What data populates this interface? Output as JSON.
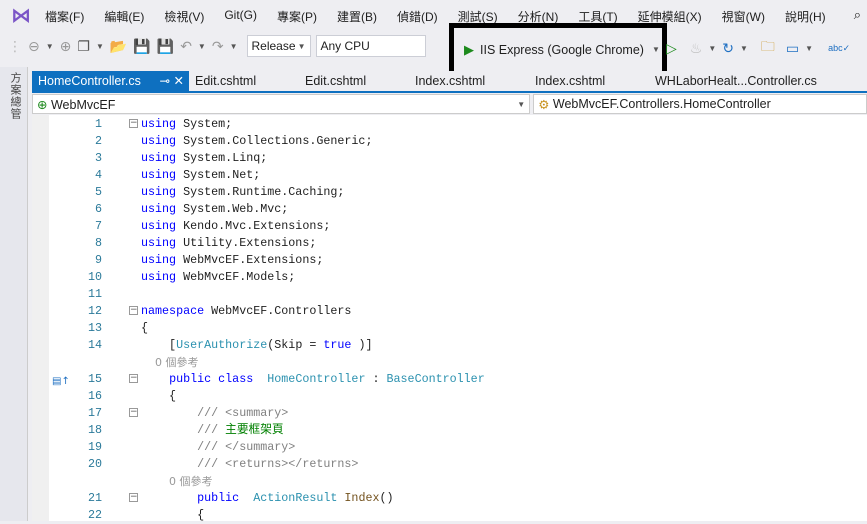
{
  "menu": [
    "檔案(F)",
    "編輯(E)",
    "檢視(V)",
    "Git(G)",
    "專案(P)",
    "建置(B)",
    "偵錯(D)",
    "測試(S)",
    "分析(N)",
    "工具(T)",
    "延伸模組(X)",
    "視窗(W)",
    "說明(H)"
  ],
  "toolbar": {
    "configuration": "Release",
    "platform": "Any CPU",
    "run_target": "IIS Express (Google Chrome)"
  },
  "sidebar": {
    "label": "方案總管"
  },
  "tabs": [
    {
      "label": "HomeController.cs",
      "active": true
    },
    {
      "label": "Edit.cshtml"
    },
    {
      "label": "Edit.cshtml"
    },
    {
      "label": "Index.cshtml"
    },
    {
      "label": "Index.cshtml"
    },
    {
      "label": "WHLaborHealt...Controller.cs"
    }
  ],
  "nav": {
    "project": "WebMvcEF",
    "class": "WebMvcEF.Controllers.HomeController"
  },
  "lines": [
    {
      "n": "1",
      "t": [
        [
          "kw",
          "using"
        ],
        [
          "",
          "System;"
        ]
      ]
    },
    {
      "n": "2",
      "t": [
        [
          "kw",
          "using"
        ],
        [
          "",
          "System.Collections.Generic;"
        ]
      ]
    },
    {
      "n": "3",
      "t": [
        [
          "kw",
          "using"
        ],
        [
          "",
          "System.Linq;"
        ]
      ]
    },
    {
      "n": "4",
      "t": [
        [
          "kw",
          "using"
        ],
        [
          "",
          "System.Net;"
        ]
      ]
    },
    {
      "n": "5",
      "t": [
        [
          "kw",
          "using"
        ],
        [
          "",
          "System.Runtime.Caching;"
        ]
      ]
    },
    {
      "n": "6",
      "t": [
        [
          "kw",
          "using"
        ],
        [
          "",
          "System.Web.Mvc;"
        ]
      ]
    },
    {
      "n": "7",
      "t": [
        [
          "kw",
          "using"
        ],
        [
          "",
          "Kendo.Mvc.Extensions;"
        ]
      ]
    },
    {
      "n": "8",
      "t": [
        [
          "kw",
          "using"
        ],
        [
          "",
          "Utility.Extensions;"
        ]
      ]
    },
    {
      "n": "9",
      "t": [
        [
          "kw",
          "using"
        ],
        [
          "",
          "WebMvcEF.Extensions;"
        ]
      ]
    },
    {
      "n": "10",
      "t": [
        [
          "kw",
          "using"
        ],
        [
          "",
          "WebMvcEF.Models;"
        ]
      ]
    },
    {
      "n": "11",
      "t": []
    },
    {
      "n": "12",
      "t": [
        [
          "kw",
          "namespace"
        ],
        [
          "",
          "WebMvcEF.Controllers"
        ]
      ]
    },
    {
      "n": "13",
      "t": [
        [
          "",
          "{"
        ]
      ]
    },
    {
      "n": "14",
      "t": [
        [
          "",
          "    ["
        ],
        [
          "ty",
          "UserAuthorize"
        ],
        [
          "",
          "(Skip = "
        ],
        [
          "kw",
          "true"
        ],
        [
          "",
          ")]"
        ]
      ]
    },
    {
      "n": "",
      "t": [
        [
          "lens",
          "    0 個參考"
        ]
      ]
    },
    {
      "n": "15",
      "t": [
        [
          "",
          "    "
        ],
        [
          "kw",
          "public class"
        ],
        [
          "",
          ""
        ],
        [
          "ty",
          "HomeController"
        ],
        [
          "",
          " : "
        ],
        [
          "ty",
          "BaseController"
        ]
      ]
    },
    {
      "n": "16",
      "t": [
        [
          "",
          "    {"
        ]
      ]
    },
    {
      "n": "17",
      "t": [
        [
          "cm",
          "        /// <summary>"
        ]
      ]
    },
    {
      "n": "18",
      "t": [
        [
          "cm",
          "        /// "
        ],
        [
          "cmg",
          "主要框架頁"
        ]
      ]
    },
    {
      "n": "19",
      "t": [
        [
          "cm",
          "        /// </summary>"
        ]
      ]
    },
    {
      "n": "20",
      "t": [
        [
          "cm",
          "        /// <returns></returns>"
        ]
      ]
    },
    {
      "n": "",
      "t": [
        [
          "lens",
          "        0 個參考"
        ]
      ]
    },
    {
      "n": "21",
      "t": [
        [
          "",
          "        "
        ],
        [
          "kw",
          "public"
        ],
        [
          "",
          ""
        ],
        [
          "ty",
          "ActionResult"
        ],
        [
          "",
          ""
        ],
        [
          "mt",
          "Index"
        ],
        [
          "",
          "()"
        ]
      ]
    },
    {
      "n": "22",
      "t": [
        [
          "",
          "        {"
        ]
      ]
    }
  ]
}
